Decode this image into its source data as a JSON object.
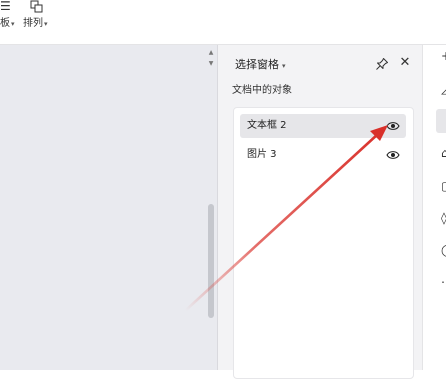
{
  "toolbar": {
    "left_item": {
      "icon": "template-icon",
      "label": "板"
    },
    "arrange": {
      "icon": "arrange-icon",
      "label": "排列"
    }
  },
  "selection_pane": {
    "title": "选择窗格",
    "subtitle": "文档中的对象",
    "objects": [
      {
        "label": "文本框 2",
        "selected": true,
        "icon": "eye-icon"
      },
      {
        "label": "图片 3",
        "selected": false,
        "icon": "eye-icon"
      }
    ]
  },
  "annotation": {
    "color": "#d9302a"
  },
  "colors": {
    "canvas": "#e9eaef",
    "panel": "#f3f3f5",
    "selected_row": "#e6e6e9"
  }
}
